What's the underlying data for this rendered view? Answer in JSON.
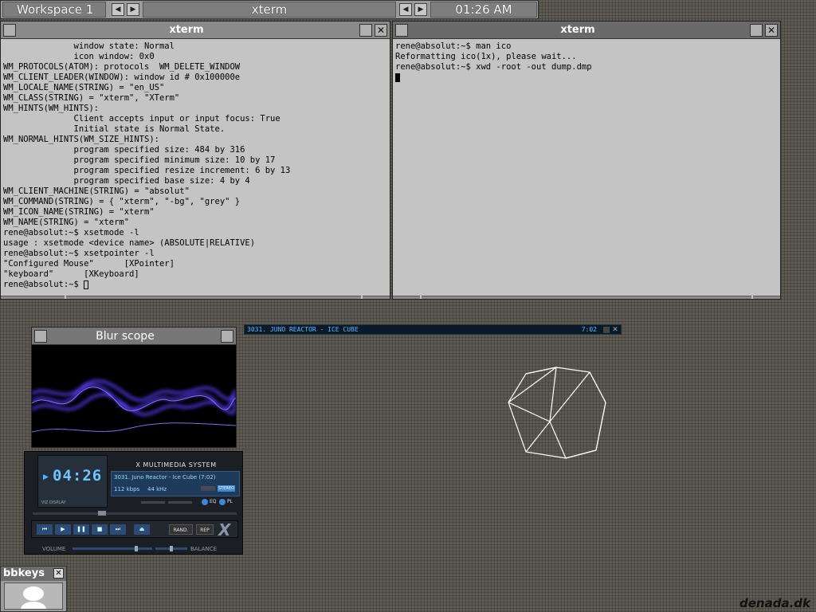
{
  "toolbar": {
    "workspace": "Workspace 1",
    "window_title": "xterm",
    "clock": "01:26 AM"
  },
  "xterm_left": {
    "title": "xterm",
    "lines": [
      "              window state: Normal",
      "              icon window: 0x0",
      "WM_PROTOCOLS(ATOM): protocols  WM_DELETE_WINDOW",
      "WM_CLIENT_LEADER(WINDOW): window id # 0x100000e",
      "WM_LOCALE_NAME(STRING) = \"en_US\"",
      "WM_CLASS(STRING) = \"xterm\", \"XTerm\"",
      "WM_HINTS(WM_HINTS):",
      "              Client accepts input or input focus: True",
      "              Initial state is Normal State.",
      "WM_NORMAL_HINTS(WM_SIZE_HINTS):",
      "              program specified size: 484 by 316",
      "              program specified minimum size: 10 by 17",
      "              program specified resize increment: 6 by 13",
      "              program specified base size: 4 by 4",
      "WM_CLIENT_MACHINE(STRING) = \"absolut\"",
      "WM_COMMAND(STRING) = { \"xterm\", \"-bg\", \"grey\" }",
      "WM_ICON_NAME(STRING) = \"xterm\"",
      "WM_NAME(STRING) = \"xterm\"",
      "rene@absolut:~$ xsetmode -l",
      "usage : xsetmode <device name> (ABSOLUTE|RELATIVE)",
      "rene@absolut:~$ xsetpointer -l",
      "\"Configured Mouse\"      [XPointer]",
      "\"keyboard\"      [XKeyboard]",
      "rene@absolut:~$ "
    ]
  },
  "xterm_right": {
    "title": "xterm",
    "lines": [
      "rene@absolut:~$ man ico",
      "Reformatting ico(1x), please wait...",
      "rene@absolut:~$ xwd -root -out dump.dmp"
    ]
  },
  "blur_scope": {
    "title": "Blur scope"
  },
  "xmms": {
    "header": "X MULTIMEDIA SYSTEM",
    "time": "04:26",
    "song": "3031. Juno Reactor - Ice Cube (7:02)",
    "kbps": "112 kbps",
    "khz": "44 kHz",
    "mono": "MONO",
    "stereo": "STEREO",
    "eq": "EQ",
    "pl": "PL",
    "shuffle": "RAND.",
    "repeat": "REP",
    "volume_label": "VOLUME",
    "balance_label": "BALANCE",
    "vis_label": "VIZ DISPLAY"
  },
  "playlist_bar": {
    "track": "3031. JUNO REACTOR - ICE CUBE",
    "time": "7:02"
  },
  "bbkeys": {
    "title": "bbkeys"
  },
  "watermark": "denada.dk",
  "icons": [
    "left-arrow-icon",
    "right-arrow-icon",
    "close-icon",
    "minimize-icon",
    "maximize-icon",
    "play-icon",
    "pause-icon",
    "stop-icon",
    "previous-icon",
    "next-icon",
    "eject-icon"
  ]
}
